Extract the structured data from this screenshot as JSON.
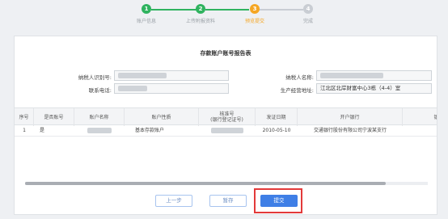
{
  "stepper": {
    "steps": [
      {
        "num": "1",
        "label": "账户信息",
        "state": "done"
      },
      {
        "num": "2",
        "label": "上传附报资料",
        "state": "done"
      },
      {
        "num": "3",
        "label": "预览提交",
        "state": "active"
      },
      {
        "num": "4",
        "label": "完成",
        "state": "pending"
      }
    ]
  },
  "report": {
    "title": "存款账户账号报告表",
    "taxpayer_id_label": "纳税人识别号:",
    "taxpayer_name_label": "纳税人名称:",
    "phone_label": "联系电话:",
    "address_label": "生产经营地址:",
    "address_value": "江北区北岸财富中心3栋（4-4）室"
  },
  "table": {
    "headers": [
      "序号",
      "是否账号",
      "账户名称",
      "账户性质",
      "核准号\n(银行登记证号)",
      "发证日期",
      "开户银行",
      "银行"
    ],
    "rows": [
      [
        "1",
        "是",
        "",
        "基本存款账户",
        "",
        "2010-05-10",
        "交通银行股份有限公司宁波某支行",
        ""
      ]
    ]
  },
  "buttons": {
    "prev": "上一步",
    "save": "暂存",
    "submit": "提交"
  },
  "colors": {
    "done": "#2fb35f",
    "active": "#f5a623",
    "pending": "#c9cdd3",
    "primary": "#3f7fe6",
    "highlight": "#e33a3a"
  }
}
